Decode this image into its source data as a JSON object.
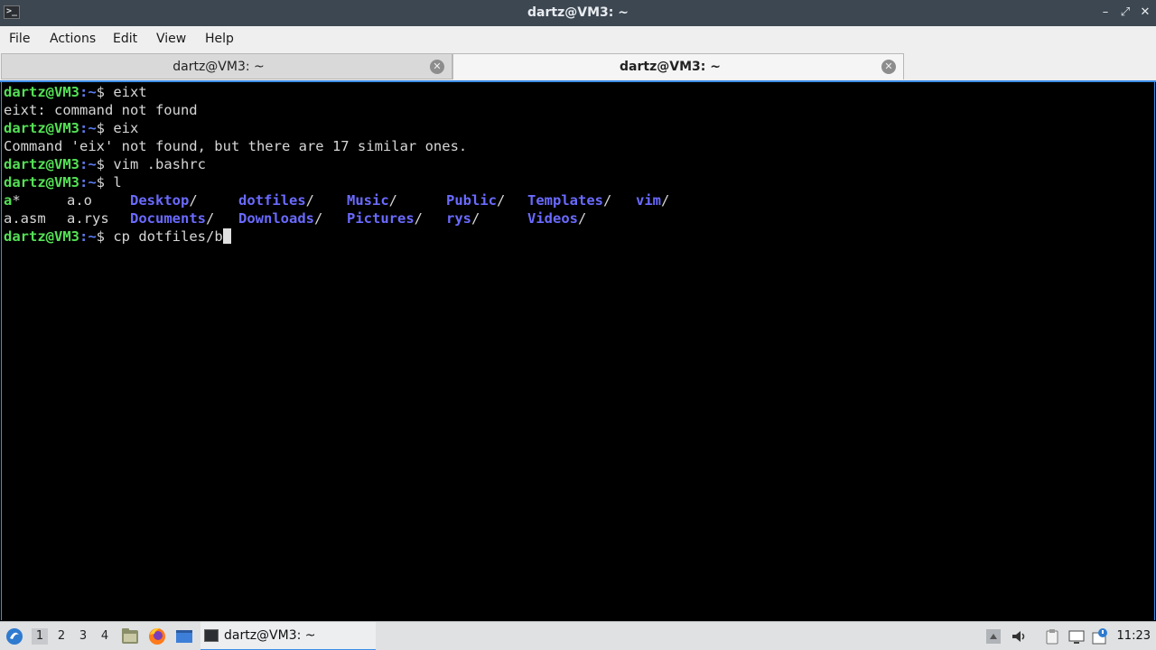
{
  "window": {
    "title": "dartz@VM3: ~",
    "app_icon_glyph": ">_",
    "controls": {
      "minimize": "–",
      "maximize": "⤢",
      "close": "✕"
    }
  },
  "menu": [
    "File",
    "Actions",
    "Edit",
    "View",
    "Help"
  ],
  "tabs": [
    {
      "label": "dartz@VM3: ~",
      "active": false
    },
    {
      "label": "dartz@VM3: ~",
      "active": true
    }
  ],
  "terminal": {
    "lines": [
      {
        "prompt": "dartz@VM3",
        "dir": ":~",
        "sym": "$ ",
        "cmd": "eixt"
      },
      {
        "text": "eixt: command not found"
      },
      {
        "prompt": "dartz@VM3",
        "dir": ":~",
        "sym": "$ ",
        "cmd": "eix"
      },
      {
        "text": "Command 'eix' not found, but there are 17 similar ones."
      },
      {
        "prompt": "dartz@VM3",
        "dir": ":~",
        "sym": "$ ",
        "cmd": "vim .bashrc"
      },
      {
        "prompt": "dartz@VM3",
        "dir": ":~",
        "sym": "$ ",
        "cmd": "l"
      }
    ],
    "listing_row1": [
      {
        "name": "a",
        "suffix": "*",
        "kind": "exe"
      },
      {
        "name": "a.o",
        "suffix": "",
        "kind": "file"
      },
      {
        "name": "Desktop",
        "suffix": "/",
        "kind": "dir"
      },
      {
        "name": "dotfiles",
        "suffix": "/",
        "kind": "dir"
      },
      {
        "name": "Music",
        "suffix": "/",
        "kind": "dir"
      },
      {
        "name": "Public",
        "suffix": "/",
        "kind": "dir"
      },
      {
        "name": "Templates",
        "suffix": "/",
        "kind": "dir"
      },
      {
        "name": "vim",
        "suffix": "/",
        "kind": "dir"
      }
    ],
    "listing_row2": [
      {
        "name": "a.asm",
        "suffix": "",
        "kind": "file"
      },
      {
        "name": "a.rys",
        "suffix": "",
        "kind": "file"
      },
      {
        "name": "Documents",
        "suffix": "/",
        "kind": "dir"
      },
      {
        "name": "Downloads",
        "suffix": "/",
        "kind": "dir"
      },
      {
        "name": "Pictures",
        "suffix": "/",
        "kind": "dir"
      },
      {
        "name": "rys",
        "suffix": "/",
        "kind": "dir"
      },
      {
        "name": "Videos",
        "suffix": "/",
        "kind": "dir"
      }
    ],
    "current": {
      "prompt": "dartz@VM3",
      "dir": ":~",
      "sym": "$ ",
      "cmd": "cp dotfiles/b"
    }
  },
  "taskbar": {
    "workspaces": [
      "1",
      "2",
      "3",
      "4"
    ],
    "current_workspace": "1",
    "launchers": [
      "file-manager-icon",
      "firefox-icon",
      "desktop-icon"
    ],
    "task_label": "dartz@VM3: ~",
    "tray": [
      "arrow-up-icon",
      "volume-icon",
      "clipboard-icon",
      "monitor-icon",
      "info-icon"
    ],
    "clock": "11:23"
  },
  "colors": {
    "accent": "#3d8ee8",
    "prompt": "#54e155",
    "directory": "#6a6aff",
    "titlebar": "#3d4751"
  }
}
